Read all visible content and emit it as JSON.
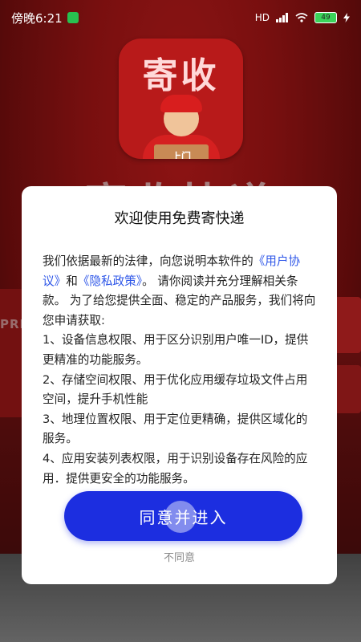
{
  "status_bar": {
    "time": "傍晚6:21",
    "network": "HD",
    "battery": "49",
    "icons": [
      "signal-icon",
      "wifi-icon",
      "battery-icon",
      "charging-icon"
    ]
  },
  "splash": {
    "app_icon_title": "寄收",
    "app_icon_box_text": "上门",
    "background_title": "寄收快递",
    "background_truck_text": "PRES"
  },
  "dialog": {
    "title": "欢迎使用免费寄快递",
    "intro_prefix": "我们依据最新的法律，向您说明本软件的",
    "user_agreement_link": "《用户协议》",
    "and_text": "和",
    "privacy_policy_link": "《隐私政策》",
    "intro_suffix": "。 请你阅读并充分理解相关条款。 为了给您提供全面、稳定的产品服务，我们将向您申请获取:",
    "items": [
      "1、设备信息权限、用于区分识别用户唯一ID，提供更精准的功能服务。",
      "2、存储空间权限、用于优化应用缓存垃圾文件占用空间，提升手机性能",
      "3、地理位置权限、用于定位更精确，提供区域化的服务。",
      "4、应用安装列表权限，用于识别设备存在风险的应用．提供更安全的功能服务。"
    ],
    "agree_button": "同意并进入",
    "disagree_link": "不同意"
  },
  "colors": {
    "brand_red": "#b81a1a",
    "link_blue": "#2f57e8",
    "button_blue": "#1c2ee0"
  }
}
